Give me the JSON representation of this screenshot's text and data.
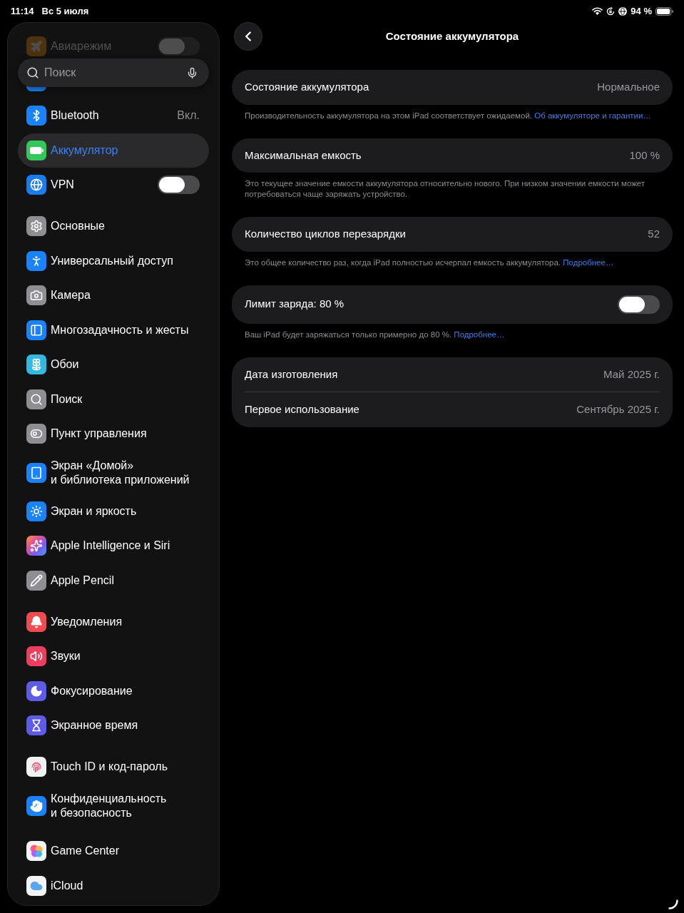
{
  "status_bar": {
    "time": "11:14",
    "date": "Вс 5 июля",
    "battery_percent": "94 %"
  },
  "sidebar": {
    "partly_hidden_item": {
      "label": "Авиарежим",
      "on": false
    },
    "search": {
      "placeholder": "Поиск"
    },
    "groups": [
      [
        {
          "kind": "value",
          "label": "Bluetooth",
          "value": "Вкл.",
          "selected": false
        },
        {
          "kind": "plain",
          "label": "Аккумулятор",
          "selected": true
        },
        {
          "kind": "toggle",
          "label": "VPN",
          "on": false,
          "selected": false
        }
      ],
      [
        {
          "kind": "plain",
          "label": "Основные",
          "selected": false
        },
        {
          "kind": "plain",
          "label": "Универсальный доступ",
          "selected": false
        },
        {
          "kind": "plain",
          "label": "Камера",
          "selected": false
        },
        {
          "kind": "plain",
          "label": "Многозадачность и жесты",
          "selected": false
        },
        {
          "kind": "plain",
          "label": "Обои",
          "selected": false
        },
        {
          "kind": "plain",
          "label": "Поиск",
          "selected": false
        },
        {
          "kind": "plain",
          "label": "Пункт управления",
          "selected": false
        },
        {
          "kind": "plain",
          "label": "Экран «Домой»\nи библиотека приложений",
          "selected": false
        },
        {
          "kind": "plain",
          "label": "Экран и яркость",
          "selected": false
        },
        {
          "kind": "plain",
          "label": "Apple Intelligence и Siri",
          "selected": false
        },
        {
          "kind": "plain",
          "label": "Apple Pencil",
          "selected": false
        }
      ],
      [
        {
          "kind": "plain",
          "label": "Уведомления",
          "selected": false
        },
        {
          "kind": "plain",
          "label": "Звуки",
          "selected": false
        },
        {
          "kind": "plain",
          "label": "Фокусирование",
          "selected": false
        },
        {
          "kind": "plain",
          "label": "Экранное время",
          "selected": false
        }
      ],
      [
        {
          "kind": "plain",
          "label": "Touch ID и код-пароль",
          "selected": false
        },
        {
          "kind": "plain",
          "label": "Конфиденциальность\nи безопасность",
          "selected": false
        }
      ],
      [
        {
          "kind": "plain",
          "label": "Game Center",
          "selected": false
        },
        {
          "kind": "plain",
          "label": "iCloud",
          "selected": false
        }
      ]
    ]
  },
  "detail": {
    "title": "Состояние аккумулятора",
    "sections": [
      {
        "rows": [
          {
            "kind": "value",
            "label": "Состояние аккумулятора",
            "value": "Нормальное"
          }
        ],
        "footer": {
          "text": "Производительность аккумулятора на этом iPad соответствует ожидаемой.",
          "link": "Об аккумуляторе и гарантии…"
        }
      },
      {
        "rows": [
          {
            "kind": "value",
            "label": "Максимальная емкость",
            "value": "100 %"
          }
        ],
        "footer": {
          "text": "Это текущее значение емкости аккумулятора относительно нового. При низком значении емкости может потребоваться чаще заряжать устройство."
        }
      },
      {
        "rows": [
          {
            "kind": "value",
            "label": "Количество циклов перезарядки",
            "value": "52"
          }
        ],
        "footer": {
          "text": "Это общее количество раз, когда iPad полностью исчерпал емкость аккумулятора.",
          "link": "Подробнее…"
        }
      },
      {
        "rows": [
          {
            "kind": "toggle",
            "label": "Лимит заряда: 80 %",
            "on": false
          }
        ],
        "footer": {
          "text": "Ваш iPad будет заряжаться только примерно до 80 %.",
          "link": "Подробнее…"
        }
      },
      {
        "rows": [
          {
            "kind": "value",
            "label": "Дата изготовления",
            "value": "Май 2025 г."
          },
          {
            "kind": "value",
            "label": "Первое использование",
            "value": "Сентябрь 2025 г."
          }
        ]
      }
    ]
  }
}
